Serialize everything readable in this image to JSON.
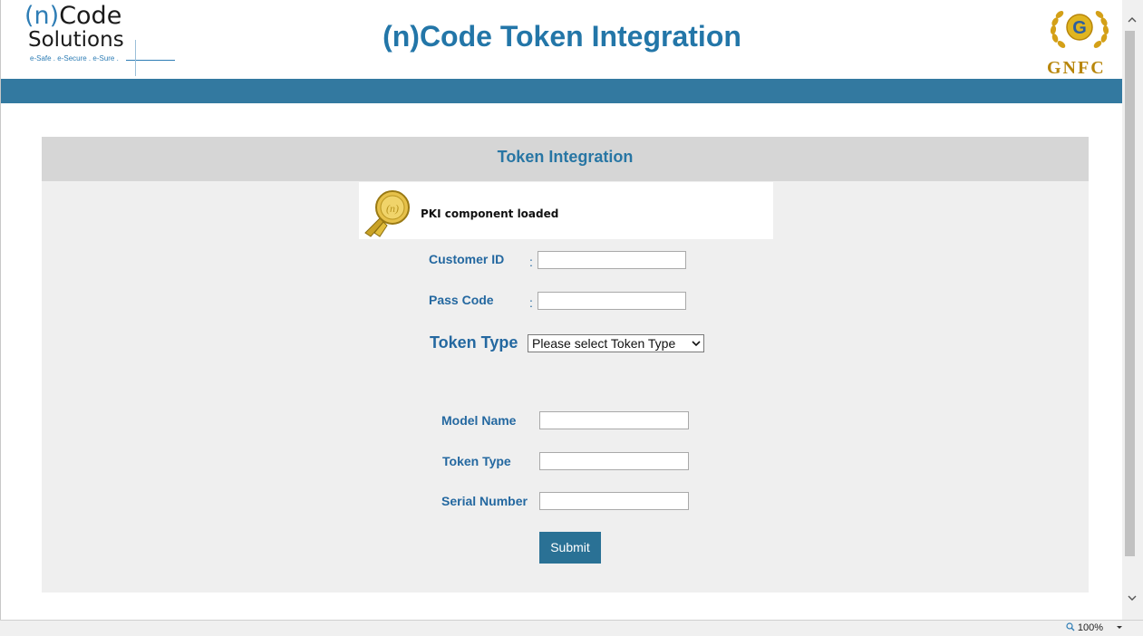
{
  "header": {
    "logo": {
      "line1_paren": "(n)",
      "line1_word": "Code",
      "line2": "Solutions",
      "tagline": "e-Safe . e-Secure . e-Sure ."
    },
    "title": "(n)Code Token Integration",
    "right_logo": {
      "emblem_letter": "G",
      "text": "GNFC"
    }
  },
  "panel": {
    "heading": "Token Integration",
    "pki_status": "PKI component loaded",
    "form": {
      "customer_id_label": "Customer ID",
      "pass_code_label": "Pass Code",
      "colon": ":",
      "token_type_label": "Token Type",
      "token_type_selected": "Please select Token Type",
      "model_name_label": "Model Name",
      "token_type_field_label": "Token Type",
      "serial_number_label": "Serial Number",
      "customer_id_value": "",
      "pass_code_value": "",
      "model_name_value": "",
      "token_type_value": "",
      "serial_number_value": "",
      "submit_label": "Submit"
    }
  },
  "statusbar": {
    "zoom": "100%"
  },
  "colors": {
    "brand_blue": "#2376a8",
    "bar_blue": "#3379a0",
    "button_blue": "#2a7195",
    "gold": "#c9a227"
  },
  "icons": [
    "pki-seal-icon",
    "gnfc-emblem-icon",
    "scroll-up-icon",
    "scroll-down-icon",
    "zoom-icon",
    "chevron-down-icon"
  ]
}
